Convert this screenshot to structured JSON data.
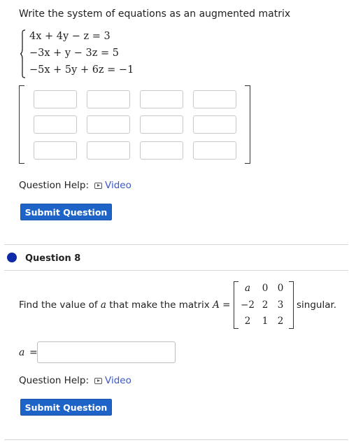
{
  "question7": {
    "prompt": "Write the system of equations as an augmented matrix",
    "equations": [
      "4x + 4y − z = 3",
      "−3x + y − 3z = 5",
      "−5x + 5y + 6z = −1"
    ],
    "matrix_rows": 3,
    "matrix_cols": 4,
    "help_label": "Question Help:",
    "video_label": "Video",
    "submit_label": "Submit Question"
  },
  "question8": {
    "title": "Question 8",
    "prompt_before": "Find the value of",
    "prompt_var": "a",
    "prompt_mid": "that make the matrix",
    "matrix_name": "A",
    "equals": "=",
    "matrix": [
      [
        "a",
        "0",
        "0"
      ],
      [
        "−2",
        "2",
        "3"
      ],
      [
        "2",
        "1",
        "2"
      ]
    ],
    "prompt_after": "singular.",
    "answer_var": "a",
    "answer_value": "",
    "help_label": "Question Help:",
    "video_label": "Video",
    "submit_label": "Submit Question"
  },
  "colors": {
    "accent": "#1e64c8",
    "link": "#3a57c4",
    "question_dot": "#0d2aa8"
  },
  "icons": {
    "video": "play-icon"
  }
}
